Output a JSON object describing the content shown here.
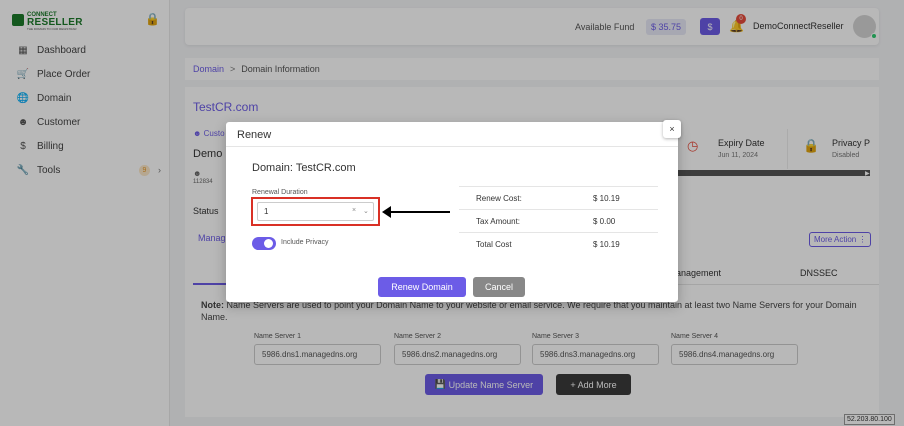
{
  "brand": {
    "line1": "CONNECT",
    "line2": "RESELLER",
    "tagline": "THE DOMAIN TO OUR REGISTRAR"
  },
  "sidebar": {
    "items": [
      {
        "label": "Dashboard",
        "icon": "grid-icon"
      },
      {
        "label": "Place Order",
        "icon": "cart-icon"
      },
      {
        "label": "Domain",
        "icon": "globe-icon"
      },
      {
        "label": "Customer",
        "icon": "user-icon"
      },
      {
        "label": "Billing",
        "icon": "dollar-icon"
      },
      {
        "label": "Tools",
        "icon": "wrench-icon",
        "badge": "9"
      }
    ]
  },
  "header": {
    "fund_label": "Available Fund",
    "fund_value": "$ 35.75",
    "dollar_button": "$",
    "notification_count": "0",
    "username": "DemoConnectReseller"
  },
  "breadcrumb": {
    "link": "Domain",
    "separator": ">",
    "current": "Domain Information"
  },
  "domain_page": {
    "title": "TestCR.com",
    "customer_tab": "Custo",
    "customer_name": "Demo",
    "customer_id": "112834",
    "status_label": "Status",
    "manage_tab": "Manag",
    "expiry": {
      "label": "Expiry Date",
      "value": "Jun 11, 2024"
    },
    "privacy": {
      "label": "Privacy P",
      "value": "Disabled"
    },
    "more_action": "More Action ⋮",
    "tab_management": "anagement",
    "tab_dnssec": "DNSSEC",
    "note_bold": "Note:",
    "note_text": "Name Servers are used to point your Domain Name to your website or email service. We require that you maintain at least two Name Servers for your Domain Name.",
    "name_servers": [
      {
        "label": "Name Server 1",
        "value": "5986.dns1.managedns.org"
      },
      {
        "label": "Name Server 2",
        "value": "5986.dns2.managedns.org"
      },
      {
        "label": "Name Server 3",
        "value": "5986.dns3.managedns.org"
      },
      {
        "label": "Name Server 4",
        "value": "5986.dns4.managedns.org"
      }
    ],
    "update_button": "Update Name Server",
    "add_more_button": "+ Add More"
  },
  "modal": {
    "title": "Renew",
    "close": "×",
    "domain_line": "Domain: TestCR.com",
    "renewal_label": "Renewal Duration",
    "renewal_value": "1",
    "clear_symbol": "×",
    "include_privacy_label": "Include Privacy",
    "include_privacy_on": true,
    "costs": [
      {
        "label": "Renew Cost:",
        "value": "$ 10.19"
      },
      {
        "label": "Tax Amount:",
        "value": "$ 0.00"
      },
      {
        "label": "Total Cost",
        "value": "$ 10.19"
      }
    ],
    "renew_button": "Renew Domain",
    "cancel_button": "Cancel"
  },
  "ip_tag": "52.203.80.100",
  "colors": {
    "accent": "#6c5ce7",
    "brand_green": "#1c7a2a",
    "highlight_red": "#d93025"
  }
}
